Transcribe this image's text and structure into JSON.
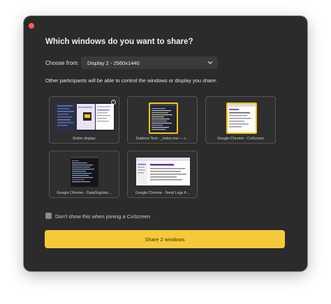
{
  "dialog": {
    "title": "Which windows do you want to share?",
    "choose_from_label": "Choose from:",
    "display_select_value": "Display 2 - 2560x1440",
    "notice": "Other participants will be able to control the windows or display you share."
  },
  "tiles": [
    {
      "label": "Entire display"
    },
    {
      "label": "Sublime Text - _index.md — c..."
    },
    {
      "label": "Google Chrome - CoScreen"
    },
    {
      "label": "Google Chrome - DataDog/doc..."
    },
    {
      "label": "Google Chrome - Send Logs fr..."
    }
  ],
  "checkbox": {
    "label": "Don't show this when joining a CoScreen",
    "checked": false
  },
  "share_button": {
    "label": "Share 2 windows"
  },
  "colors": {
    "accent": "#f6c93a",
    "selected_border": "#f5c518",
    "background": "#2b2b2b",
    "close": "#ff5f57"
  }
}
